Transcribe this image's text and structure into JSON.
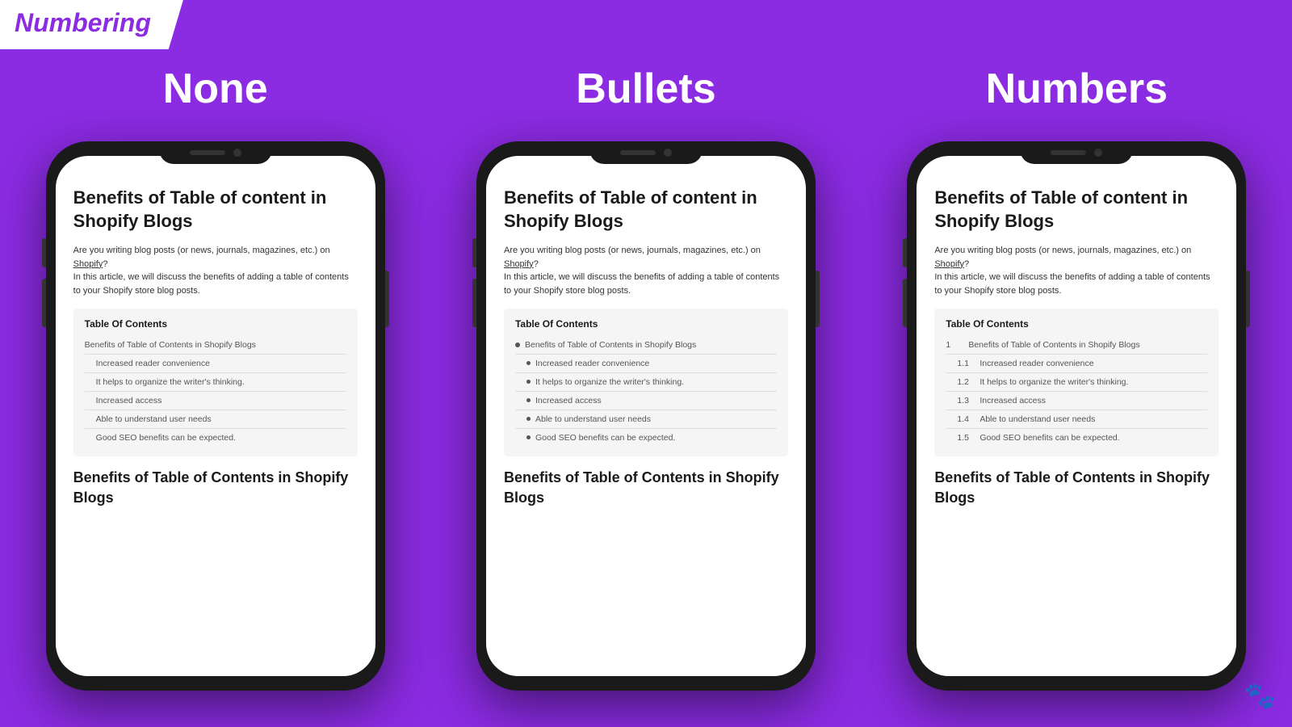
{
  "header": {
    "label": "Numbering"
  },
  "columns": [
    {
      "id": "none",
      "heading": "None"
    },
    {
      "id": "bullets",
      "heading": "Bullets"
    },
    {
      "id": "numbers",
      "heading": "Numbers"
    }
  ],
  "article": {
    "title": "Benefits of Table of content in Shopify Blogs",
    "intro_line1": "Are you writing blog posts (or news, journals, magazines, etc.) on ",
    "intro_link": "Shopify",
    "intro_line2": "?\nIn this article, we will discuss the benefits of adding a table of contents to your Shopify store blog posts.",
    "toc_heading": "Table Of Contents",
    "toc_items": [
      {
        "label": "Benefits of Table of Contents in Shopify Blogs",
        "level": 0
      },
      {
        "label": "Increased reader convenience",
        "level": 1
      },
      {
        "label": "It helps to organize the writer's thinking.",
        "level": 1
      },
      {
        "label": "Increased access",
        "level": 1
      },
      {
        "label": "Able to understand user needs",
        "level": 1
      },
      {
        "label": "Good SEO benefits can be expected.",
        "level": 1
      }
    ],
    "toc_items_numbered": [
      {
        "num": "1",
        "label": "Benefits of Table of Contents in Shopify Blogs",
        "level": 0
      },
      {
        "num": "1.1",
        "label": "Increased reader convenience",
        "level": 1
      },
      {
        "num": "1.2",
        "label": "It helps to organize the writer's thinking.",
        "level": 1
      },
      {
        "num": "1.3",
        "label": "Increased access",
        "level": 1
      },
      {
        "num": "1.4",
        "label": "Able to understand user needs",
        "level": 1
      },
      {
        "num": "1.5",
        "label": "Good SEO benefits can be expected.",
        "level": 1
      }
    ],
    "bottom_title": "Benefits of Table of Contents in Shopify Blogs"
  }
}
